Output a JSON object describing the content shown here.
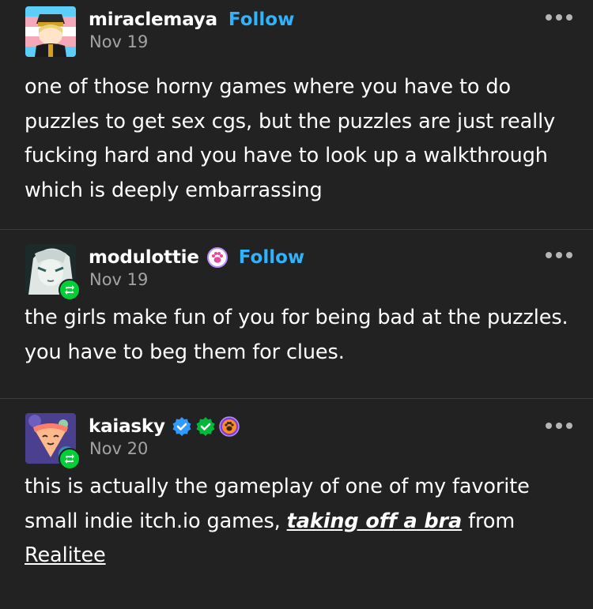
{
  "posts": [
    {
      "username": "miraclemaya",
      "follow_label": "Follow",
      "date": "Nov 19",
      "body": "one of those horny games where you have to do puzzles to get sex cgs, but the puzzles are just really fucking hard and you have to look up a walkthrough which is deeply embarrassing"
    },
    {
      "username": "modulottie",
      "follow_label": "Follow",
      "date": "Nov 19",
      "body": "the girls make fun of you for being bad at the puzzles. you have to beg them for clues."
    },
    {
      "username": "kaiasky",
      "date": "Nov 20",
      "body_prefix": "this is actually the gameplay of one of my favorite small indie itch.io games, ",
      "link_game": "taking off a bra",
      "body_mid": " from ",
      "link_author": "Realitee"
    }
  ],
  "colors": {
    "background": "#222222",
    "follow": "#2fb3ff",
    "reblog_badge": "#00cf35",
    "date": "#a3a3a3",
    "divider": "#3d3d3d"
  },
  "icons": [
    "more-options-icon",
    "reblog-icon",
    "verified-blue-icon",
    "verified-green-icon",
    "paw-badge-icon"
  ]
}
